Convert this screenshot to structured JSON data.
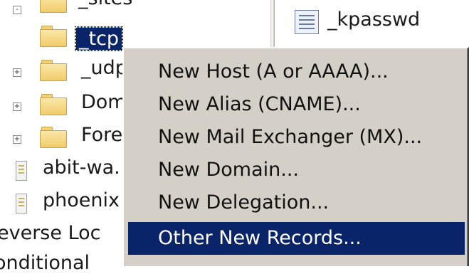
{
  "tree": {
    "items": [
      {
        "label": "_sites",
        "expander": "-",
        "icon": "folder"
      },
      {
        "label": "_tcp",
        "icon": "folder",
        "selected": true
      },
      {
        "label": "_udp",
        "expander": "+",
        "icon": "folder"
      },
      {
        "label": "Dom",
        "expander": "+",
        "icon": "folder"
      },
      {
        "label": "Fore",
        "expander": "+",
        "icon": "folder"
      },
      {
        "label": "abit-wa.",
        "icon": "record"
      },
      {
        "label": "phoenix",
        "icon": "record"
      },
      {
        "label": "everse Loc",
        "icon": "none"
      },
      {
        "label": "onditional",
        "icon": "none"
      }
    ]
  },
  "right_pane": {
    "items": [
      {
        "label": "_kpasswd",
        "icon": "record-list-icon"
      }
    ]
  },
  "context_menu": {
    "items": [
      {
        "label": "New Host (A or AAAA)..."
      },
      {
        "label": "New Alias (CNAME)..."
      },
      {
        "label": "New Mail Exchanger (MX)..."
      },
      {
        "label": "New Domain..."
      },
      {
        "label": "New Delegation..."
      },
      {
        "label": "Other New Records...",
        "highlighted": true
      }
    ]
  },
  "colors": {
    "menu_bg": "#d4d0c8",
    "highlight": "#0a246a",
    "folder": "#f1cc6a"
  }
}
